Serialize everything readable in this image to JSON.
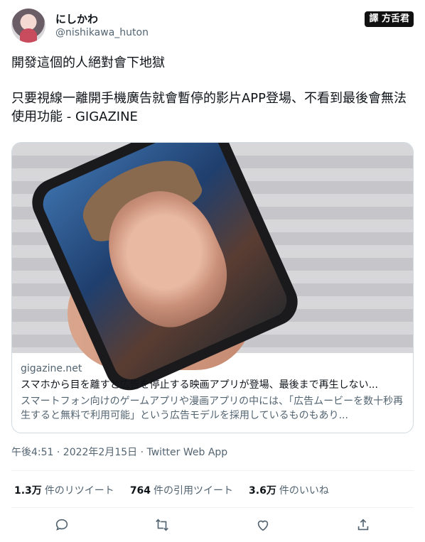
{
  "author": {
    "name": "にしかわ",
    "handle": "@nishikawa_huton"
  },
  "badge": {
    "text": "譯 方舌君"
  },
  "tweet": {
    "line1": "開發這個的人絕對會下地獄",
    "line2": "只要視線一離開手機廣告就會暫停的影片APP登場、不看到最後會無法使用功能 - GIGAZINE"
  },
  "card": {
    "domain": "gigazine.net",
    "title": "スマホから目を離すと広告を停止する映画アプリが登場、最後まで再生しない...",
    "description": "スマートフォン向けのゲームアプリや漫画アプリの中には、「広告ムービーを数十秒再生すると無料で利用可能」という広告モデルを採用しているものもあり..."
  },
  "meta": {
    "text": "午後4:51 · 2022年2月15日 · Twitter Web App"
  },
  "stats": {
    "retweets_count": "1.3万",
    "retweets_label": "件のリツイート",
    "quotes_count": "764",
    "quotes_label": "件の引用ツイート",
    "likes_count": "3.6万",
    "likes_label": "件のいいね"
  },
  "actions": {
    "reply": "reply-icon",
    "retweet": "retweet-icon",
    "like": "heart-icon",
    "share": "share-icon"
  }
}
